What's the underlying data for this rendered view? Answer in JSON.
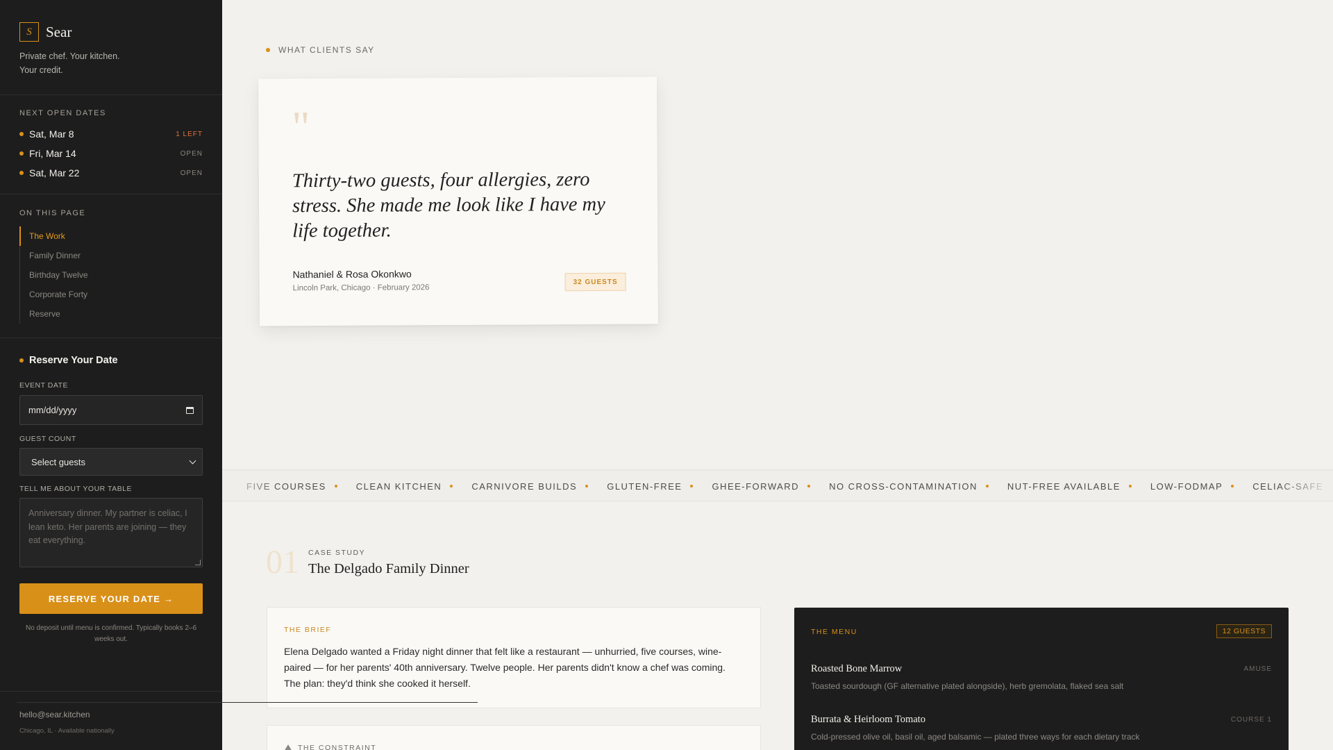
{
  "brand": {
    "logo_letter": "S",
    "name": "Sear",
    "tagline": "Private chef. Your kitchen. Your credit."
  },
  "next_dates": {
    "label": "NEXT OPEN DATES",
    "items": [
      {
        "date": "Sat, Mar 8",
        "status": "1 LEFT"
      },
      {
        "date": "Fri, Mar 14",
        "status": "OPEN"
      },
      {
        "date": "Sat, Mar 22",
        "status": "OPEN"
      }
    ]
  },
  "toc": {
    "label": "ON THIS PAGE",
    "items": [
      {
        "label": "The Work",
        "active": true
      },
      {
        "label": "Family Dinner"
      },
      {
        "label": "Birthday Twelve"
      },
      {
        "label": "Corporate Forty"
      },
      {
        "label": "Reserve"
      }
    ]
  },
  "reserve": {
    "title": "Reserve Your Date",
    "event_date_label": "EVENT DATE",
    "event_date_placeholder": "mm/dd/yyyy",
    "guest_count_label": "GUEST COUNT",
    "guest_count_value": "Select guests",
    "table_label": "TELL ME ABOUT YOUR TABLE",
    "table_placeholder": "Anniversary dinner. My partner is celiac, I lean keto. Her parents are joining — they eat everything.",
    "cta": "RESERVE YOUR DATE →",
    "fineprint": "No deposit until menu is confirmed. Typically books 2–6 weeks out."
  },
  "footer": {
    "email": "hello@sear.kitchen",
    "location": "Chicago, IL · Available nationally"
  },
  "testimonial": {
    "eyebrow": "WHAT CLIENTS SAY",
    "quote_mark": "\"",
    "quote": "Thirty-two guests, four allergies, zero stress. She made me look like I have my life together.",
    "client": "Nathaniel & Rosa Okonkwo",
    "meta": "Lincoln Park, Chicago · February 2026",
    "badge": "32 GUESTS"
  },
  "tags": [
    "FIVE COURSES",
    "CLEAN KITCHEN",
    "CARNIVORE BUILDS",
    "GLUTEN-FREE",
    "GHEE-FORWARD",
    "NO CROSS-CONTAMINATION",
    "NUT-FREE AVAILABLE",
    "LOW-FODMAP",
    "CELIAC-SAFE"
  ],
  "case": {
    "number": "01",
    "label": "CASE STUDY",
    "title": "The Delgado Family Dinner",
    "brief_label": "THE BRIEF",
    "brief_text": "Elena Delgado wanted a Friday night dinner that felt like a restaurant — unhurried, five courses, wine-paired — for her parents' 40th anniversary. Twelve people. Her parents didn't know a chef was coming. The plan: they'd think she cooked it herself.",
    "constraint_label": "THE CONSTRAINT"
  },
  "menu": {
    "label": "THE MENU",
    "badge": "12 GUESTS",
    "courses": [
      {
        "name": "Roasted Bone Marrow",
        "desc": "Toasted sourdough (GF alternative plated alongside), herb gremolata, flaked sea salt",
        "tag": "AMUSE"
      },
      {
        "name": "Burrata & Heirloom Tomato",
        "desc": "Cold-pressed olive oil, basil oil, aged balsamic — plated three ways for each dietary track",
        "tag": "COURSE 1"
      }
    ]
  },
  "colors": {
    "accent": "#d99019",
    "sidebar_bg": "#1d1d1d",
    "page_bg": "#f2f1ee",
    "warn": "#e2733f"
  }
}
